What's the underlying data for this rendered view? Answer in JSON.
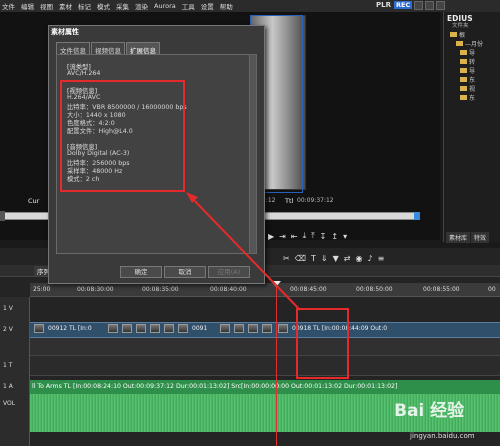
{
  "menu": [
    "文件",
    "编辑",
    "视图",
    "素材",
    "标记",
    "模式",
    "采集",
    "渲染",
    "Aurora",
    "工具",
    "设置",
    "帮助"
  ],
  "preview": {
    "plr": "PLR",
    "rec": "REC",
    "cur_label": "Cur",
    "cur_time_tail": "7:12",
    "ttl_label": "Ttl",
    "ttl_time": "00:09:37:12"
  },
  "asset_panel": {
    "title": "EDIUS",
    "folder_header": "文件夹",
    "tree": [
      "根",
      "—月份",
      "导",
      "转",
      "导",
      "东",
      "视",
      "东"
    ],
    "tabs": [
      "素材库",
      "特效"
    ]
  },
  "dialog": {
    "title": "素材属性",
    "tabs": [
      "文件信息",
      "视频信息",
      "扩展信息"
    ],
    "active_tab": 2,
    "lines": [
      {
        "text": "[流类型]",
        "head": true
      },
      {
        "text": "AVC/H.264",
        "head": false
      },
      {
        "text": "",
        "head": false
      },
      {
        "text": "[视频信息]",
        "head": true
      },
      {
        "text": "H.264/AVC",
        "head": false
      },
      {
        "text": "比特率：VBR 8500000 / 16000000 bps",
        "head": false
      },
      {
        "text": "大小：1440 x 1080",
        "head": false
      },
      {
        "text": "色度格式：4:2:0",
        "head": false
      },
      {
        "text": "配置文件：High@L4.0",
        "head": false
      },
      {
        "text": "",
        "head": false
      },
      {
        "text": "[音频信息]",
        "head": true
      },
      {
        "text": "Dolby Digital (AC-3)",
        "head": false
      },
      {
        "text": "比特率：256000 bps",
        "head": false
      },
      {
        "text": "采样率：48000 Hz",
        "head": false
      },
      {
        "text": "模式：2 ch",
        "head": false
      }
    ],
    "buttons": [
      "确定",
      "取消",
      "应用(A)"
    ]
  },
  "timeline": {
    "sequence_tab": "序列",
    "ruler": [
      "25:00",
      "00:08:30:00",
      "00:08:35:00",
      "00:08:40:00",
      "00:08:45:00",
      "00:08:50:00",
      "00:08:55:00",
      "00"
    ],
    "track_labels": [
      "1 V",
      "2 V",
      "1 T",
      "1 A",
      "VOL"
    ],
    "video_clips": [
      "00912 TL [In:0",
      "0091",
      "00918 TL [In:00:08:44:09 Out:0"
    ],
    "audio_clip": "ll To Arms  TL [In:00:08:24:10 Out:00:09:37:12 Dur:00:01:13:02]  Src[In:00:00:00:00 Out:00:01:13:02 Dur:00:01:13:02]"
  },
  "watermark": {
    "text": "Bai 经验",
    "url": "jingyan.baidu.com"
  },
  "colors": {
    "rec": "#2d6bd1",
    "annotation": "#e42a2a",
    "audio_clip": "#2e8f4a",
    "playhead": "#e03030"
  }
}
